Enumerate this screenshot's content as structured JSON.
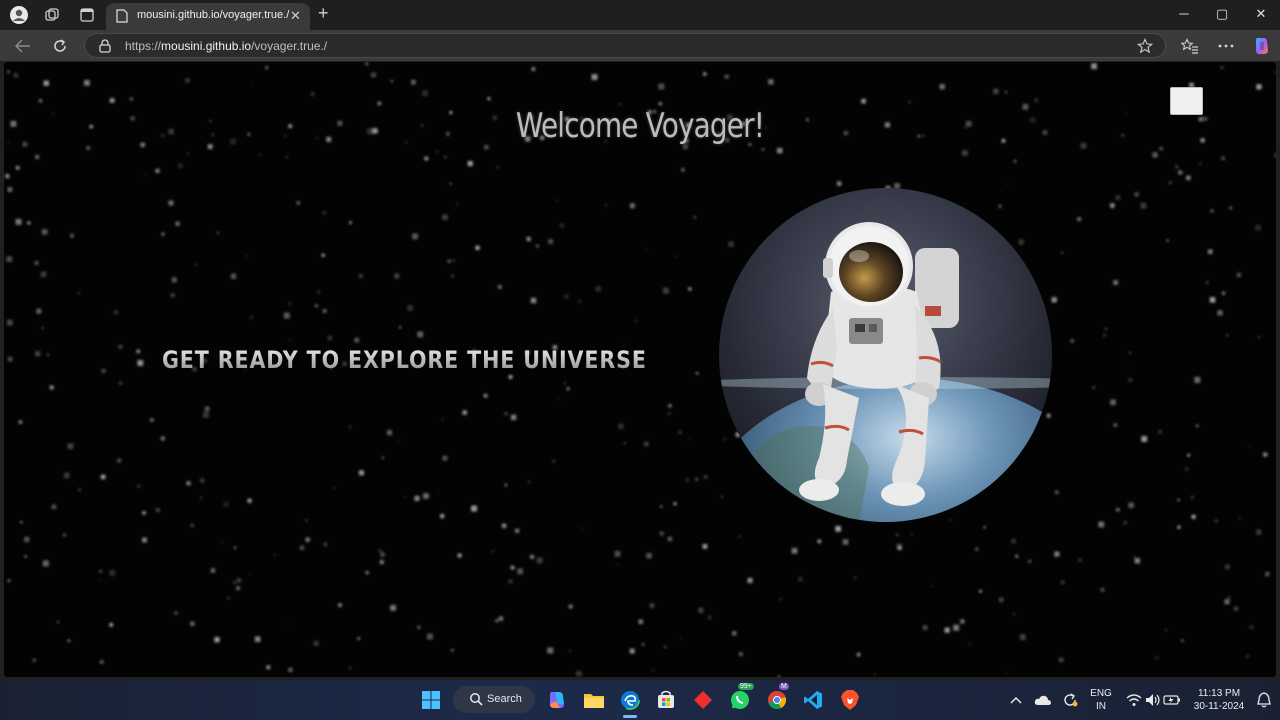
{
  "browser": {
    "tab_title": "mousini.github.io/voyager.true./",
    "url_scheme": "https://",
    "url_host": "mousini.github.io",
    "url_path": "/voyager.true./"
  },
  "page": {
    "title": "Welcome Voyager!",
    "tagline": "GET READY TO EXPLORE THE UNIVERSE"
  },
  "taskbar": {
    "search_label": "Search",
    "whatsapp_badge": "99+",
    "chrome_badge": "M",
    "language_top": "ENG",
    "language_bottom": "IN",
    "time": "11:13 PM",
    "date": "30-11-2024"
  },
  "colors": {
    "page_bg": "#030303",
    "title_text": "#bcbcbc",
    "edge_accent": "#0b7bd8"
  }
}
